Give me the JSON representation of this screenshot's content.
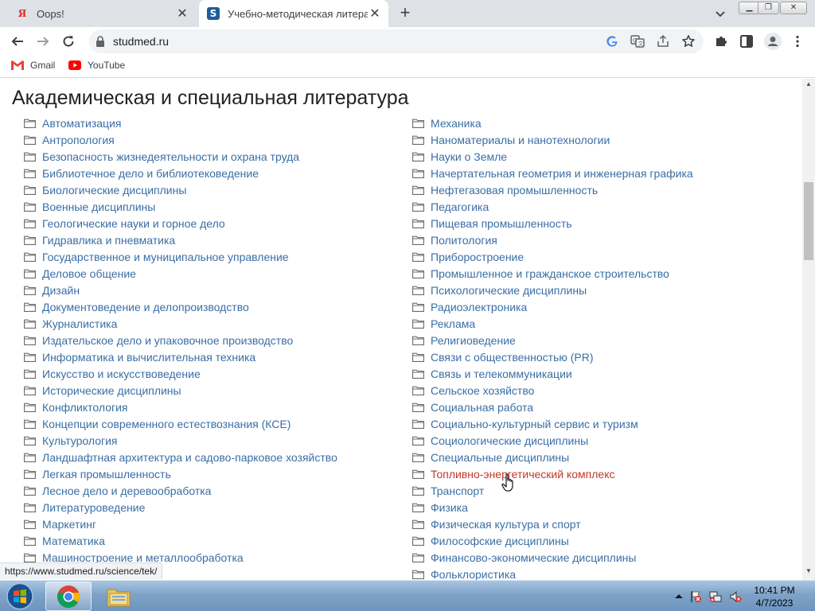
{
  "browser": {
    "tabs": [
      {
        "title": "Oops!",
        "favicon": "Я"
      },
      {
        "title": "Учебно-методическая литерат",
        "favicon": "S"
      }
    ],
    "address": "studmed.ru",
    "bookmarks": [
      {
        "label": "Gmail",
        "icon": "gmail-icon"
      },
      {
        "label": "YouTube",
        "icon": "youtube-icon"
      }
    ],
    "status_url": "https://www.studmed.ru/science/tek/"
  },
  "page": {
    "title": "Академическая и специальная литература",
    "left": [
      "Автоматизация",
      "Антропология",
      "Безопасность жизнедеятельности и охрана труда",
      "Библиотечное дело и библиотековедение",
      "Биологические дисциплины",
      "Военные дисциплины",
      "Геологические науки и горное дело",
      "Гидравлика и пневматика",
      "Государственное и муниципальное управление",
      "Деловое общение",
      "Дизайн",
      "Документоведение и делопроизводство",
      "Журналистика",
      "Издательское дело и упаковочное производство",
      "Информатика и вычислительная техника",
      "Искусство и искусствоведение",
      "Исторические дисциплины",
      "Конфликтология",
      "Концепции современного естествознания (КСЕ)",
      "Культурология",
      "Ландшафтная архитектура и садово-парковое хозяйство",
      "Легкая промышленность",
      "Лесное дело и деревообработка",
      "Литературоведение",
      "Маркетинг",
      "Математика",
      "Машиностроение и металлообработка"
    ],
    "right": [
      "Механика",
      "Наноматериалы и нанотехнологии",
      "Науки о Земле",
      "Начертательная геометрия и инженерная графика",
      "Нефтегазовая промышленность",
      "Педагогика",
      "Пищевая промышленность",
      "Политология",
      "Приборостроение",
      "Промышленное и гражданское строительство",
      "Психологические дисциплины",
      "Радиоэлектроника",
      "Реклама",
      "Религиоведение",
      "Связи с общественностью (PR)",
      "Связь и телекоммуникации",
      "Сельское хозяйство",
      "Социальная работа",
      "Социально-культурный сервис и туризм",
      "Социологические дисциплины",
      "Специальные дисциплины",
      "Топливно-энергетический комплекс",
      "Транспорт",
      "Физика",
      "Физическая культура и спорт",
      "Философские дисциплины",
      "Финансово-экономические дисциплины",
      "Фольклористика"
    ],
    "hovered_item": "Топливно-энергетический комплекс"
  },
  "taskbar": {
    "time": "10:41 PM",
    "date": "4/7/2023"
  },
  "colors": {
    "link": "#3a6ea5",
    "link_hover": "#c0392b",
    "tabstrip": "#dee1e6"
  }
}
